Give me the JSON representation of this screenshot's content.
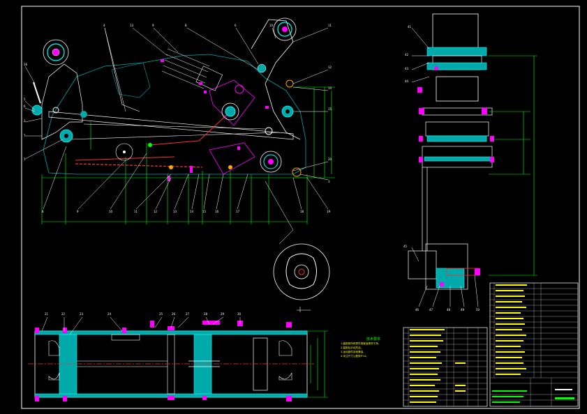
{
  "drawing": {
    "title": "",
    "colors": {
      "background": "#000000",
      "frame": "#ffffff",
      "part_outline": "#ffffff",
      "dimension": "#00ff00",
      "leader": "#ffffff",
      "hatch": "#00aaaa",
      "bolt": "#ff00ff",
      "rod": "#ff3030",
      "bearing": "#00ffff",
      "center": "#ff3030",
      "text": "#ffff00"
    }
  },
  "notes": {
    "title": "技术要求",
    "lines": [
      "1.装配前所有零件用煤油清洗干净，",
      "2.装配后手动灵活，",
      "3.运动部件涂润滑油，",
      "4.未注尺寸公差按IT14。"
    ]
  },
  "title_block": {
    "rows": 12
  }
}
